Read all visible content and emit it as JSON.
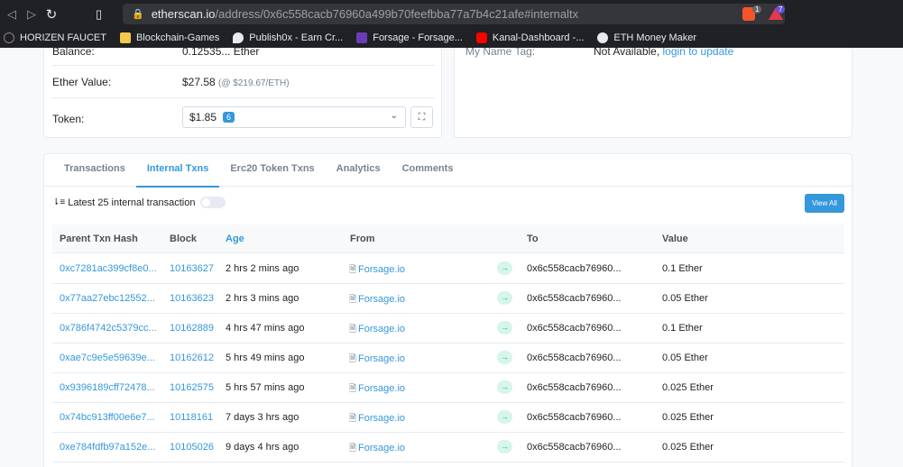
{
  "browser": {
    "url_host": "etherscan.io",
    "url_path": "/address/0x6c558cacb76960a499b70feefbba77a7b4c21afe#internaltx",
    "ext_badge1": "1",
    "ext_badge2": "7",
    "bookmarks": [
      {
        "label": "HORIZEN FAUCET",
        "color": "#1f1f1f"
      },
      {
        "label": "Blockchain-Games",
        "color": "#f4c84a"
      },
      {
        "label": "Publish0x - Earn Cr...",
        "color": "#e8eaed"
      },
      {
        "label": "Forsage - Forsage...",
        "color": "#6a3db8"
      },
      {
        "label": "Kanal-Dashboard -...",
        "color": "#ff0000"
      },
      {
        "label": "ETH Money Maker",
        "color": "#e8eaed"
      }
    ]
  },
  "overview": {
    "partial_top_label": "Balance:",
    "partial_top_value": "0.12535... Ether",
    "ether_value_label": "Ether Value:",
    "ether_value": "$27.58",
    "ether_price": "(@ $219.67/ETH)",
    "token_label": "Token:",
    "token_value": "$1.85",
    "token_count": "6"
  },
  "more_info": {
    "name_tag_label": "My Name Tag:",
    "name_tag_value": "Not Available,",
    "name_tag_link": "login to update"
  },
  "tabs": [
    "Transactions",
    "Internal Txns",
    "Erc20 Token Txns",
    "Analytics",
    "Comments"
  ],
  "active_tab": "Internal Txns",
  "table": {
    "latest_label": "Latest 25 internal transaction",
    "view_all": "View All",
    "headers": {
      "parent": "Parent Txn Hash",
      "block": "Block",
      "age": "Age",
      "from": "From",
      "to": "To",
      "value": "Value"
    },
    "rows": [
      {
        "hash": "0xc7281ac399cf8e0...",
        "block": "10163627",
        "age": "2 hrs 2 mins ago",
        "from": "Forsage.io",
        "to": "0x6c558cacb76960...",
        "value": "0.1 Ether"
      },
      {
        "hash": "0x77aa27ebc12552...",
        "block": "10163623",
        "age": "2 hrs 3 mins ago",
        "from": "Forsage.io",
        "to": "0x6c558cacb76960...",
        "value": "0.05 Ether"
      },
      {
        "hash": "0x786f4742c5379cc...",
        "block": "10162889",
        "age": "4 hrs 47 mins ago",
        "from": "Forsage.io",
        "to": "0x6c558cacb76960...",
        "value": "0.1 Ether"
      },
      {
        "hash": "0xae7c9e5e59639e...",
        "block": "10162612",
        "age": "5 hrs 49 mins ago",
        "from": "Forsage.io",
        "to": "0x6c558cacb76960...",
        "value": "0.05 Ether"
      },
      {
        "hash": "0x9396189cff72478...",
        "block": "10162575",
        "age": "5 hrs 57 mins ago",
        "from": "Forsage.io",
        "to": "0x6c558cacb76960...",
        "value": "0.025 Ether"
      },
      {
        "hash": "0x74bc913ff00e6e7...",
        "block": "10118161",
        "age": "7 days 3 hrs ago",
        "from": "Forsage.io",
        "to": "0x6c558cacb76960...",
        "value": "0.025 Ether"
      },
      {
        "hash": "0xe784fdfb97a152e...",
        "block": "10105026",
        "age": "9 days 4 hrs ago",
        "from": "Forsage.io",
        "to": "0x6c558cacb76960...",
        "value": "0.025 Ether"
      }
    ]
  }
}
